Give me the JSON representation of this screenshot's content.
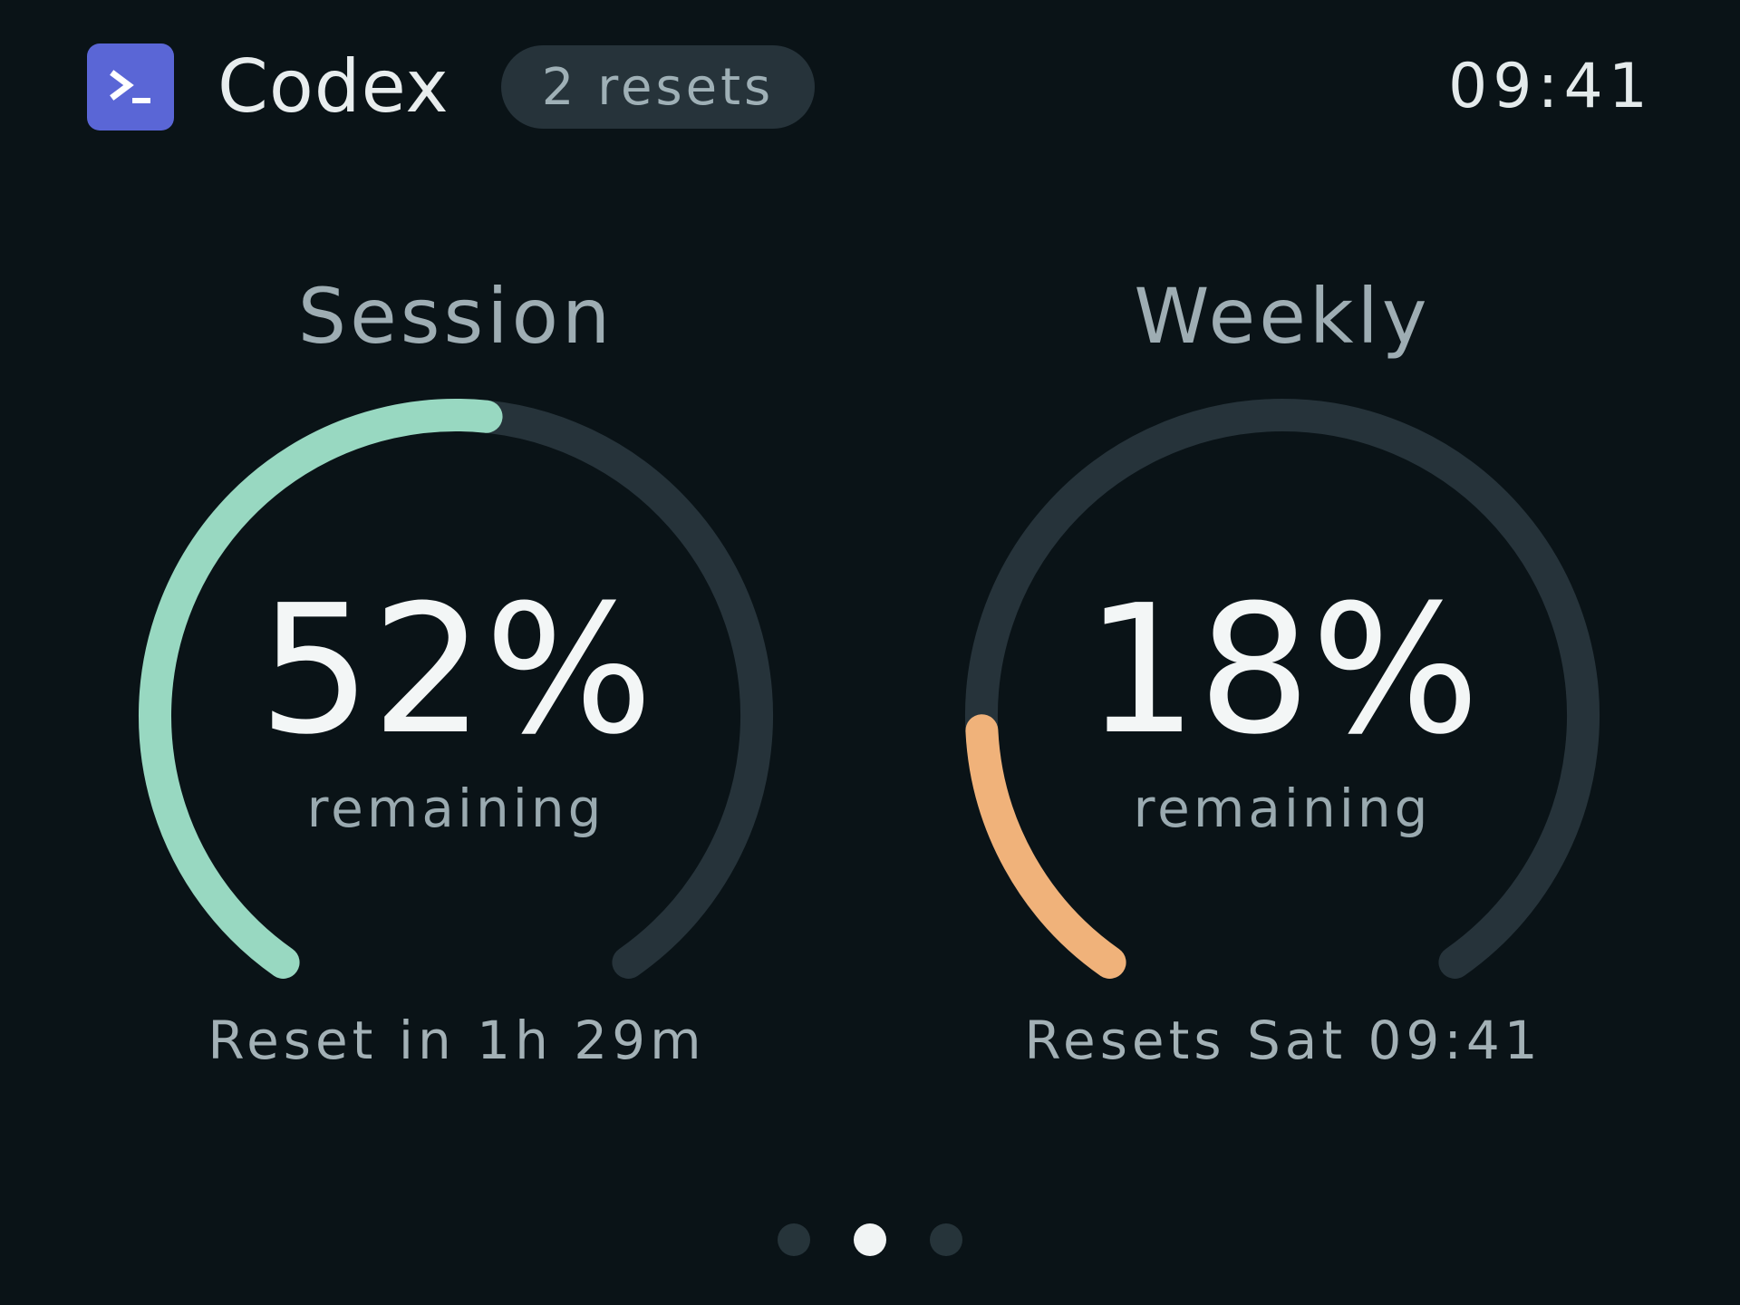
{
  "header": {
    "app_icon": "terminal-prompt-icon",
    "title": "Codex",
    "badge": "2 resets",
    "time": "09:41"
  },
  "colors": {
    "background": "#0a1317",
    "track": "#26333a",
    "session_accent": "#98d8c1",
    "weekly_accent": "#f0b27a",
    "app_icon_bg": "#5a66d6"
  },
  "gauges": [
    {
      "label": "Session",
      "value_text": "52%",
      "remaining_fraction": 0.52,
      "sub_label": "remaining",
      "footer": "Reset in 1h 29m"
    },
    {
      "label": "Weekly",
      "value_text": "18%",
      "remaining_fraction": 0.18,
      "sub_label": "remaining",
      "footer": "Resets Sat 09:41"
    }
  ],
  "pagination": {
    "count": 3,
    "active_index": 1
  }
}
